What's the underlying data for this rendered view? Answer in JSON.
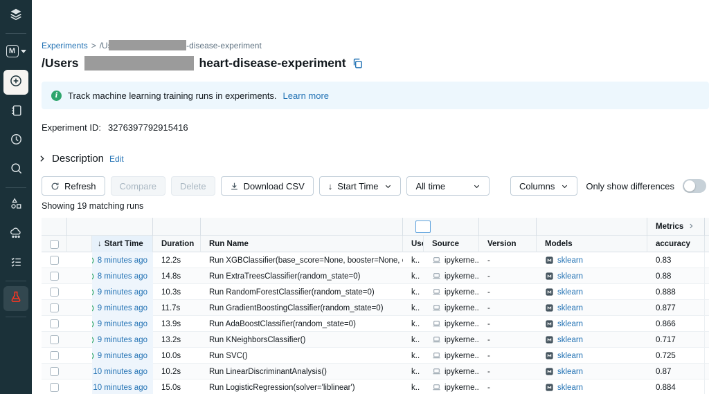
{
  "colors": {
    "sidebar_bg": "#1B3139",
    "accent_red": "#FF3621",
    "link_blue": "#2272B4",
    "banner_bg": "#EDF7FD",
    "info_green": "#2EA56C",
    "sorted_column_tint": "#EEF5FC",
    "redaction_gray": "#9B9B9B"
  },
  "sidebar": {
    "items": [
      {
        "icon": "layers-icon"
      },
      {
        "icon": "workspace-m-icon",
        "label": "M"
      },
      {
        "icon": "plus-circle-icon"
      },
      {
        "icon": "notebook-icon"
      },
      {
        "icon": "clock-icon"
      },
      {
        "icon": "search-icon"
      },
      {
        "icon": "shapes-icon"
      },
      {
        "icon": "cloud-compute-icon"
      },
      {
        "icon": "checklist-icon"
      },
      {
        "icon": "flask-icon",
        "selected": true
      }
    ]
  },
  "breadcrumb": {
    "root": "Experiments",
    "separator": ">",
    "crumb_prefix": "/User",
    "crumb_suffix": "eart-disease-experiment"
  },
  "header": {
    "title_prefix": "/Users",
    "title_name": "heart-disease-experiment"
  },
  "banner": {
    "text": "Track machine learning training runs in experiments.",
    "link": "Learn more"
  },
  "experiment": {
    "id_label": "Experiment ID:",
    "id_value": "3276397792915416"
  },
  "description": {
    "label": "Description",
    "edit": "Edit"
  },
  "toolbar": {
    "refresh": "Refresh",
    "compare": "Compare",
    "delete": "Delete",
    "download_csv": "Download CSV",
    "sort_arrow": "↓",
    "sort_label": "Start Time",
    "time_filter": "All time",
    "columns": "Columns",
    "only_show_differences": "Only show differences",
    "differences_toggle_state": "off"
  },
  "status_text": "Showing 19 matching runs",
  "table": {
    "metrics_group": "Metrics",
    "headers": {
      "start_time": "Start Time",
      "sort_arrow": "↓",
      "duration": "Duration",
      "run_name": "Run Name",
      "user": "User",
      "source": "Source",
      "version": "Version",
      "models": "Models",
      "accuracy": "accuracy"
    },
    "rows": [
      {
        "start_time": "8 minutes ago",
        "duration": "12.2s",
        "run_name": "Run XGBClassifier(base_score=None, booster=None, call...",
        "user": "k..",
        "source": "ipykerne...",
        "version": "-",
        "model": "sklearn",
        "accuracy": "0.83"
      },
      {
        "start_time": "8 minutes ago",
        "duration": "14.8s",
        "run_name": "Run ExtraTreesClassifier(random_state=0)",
        "user": "k..",
        "source": "ipykerne...",
        "version": "-",
        "model": "sklearn",
        "accuracy": "0.88"
      },
      {
        "start_time": "9 minutes ago",
        "duration": "10.3s",
        "run_name": "Run RandomForestClassifier(random_state=0)",
        "user": "k..",
        "source": "ipykerne...",
        "version": "-",
        "model": "sklearn",
        "accuracy": "0.888"
      },
      {
        "start_time": "9 minutes ago",
        "duration": "11.7s",
        "run_name": "Run GradientBoostingClassifier(random_state=0)",
        "user": "k..",
        "source": "ipykerne...",
        "version": "-",
        "model": "sklearn",
        "accuracy": "0.877"
      },
      {
        "start_time": "9 minutes ago",
        "duration": "13.9s",
        "run_name": "Run AdaBoostClassifier(random_state=0)",
        "user": "k..",
        "source": "ipykerne...",
        "version": "-",
        "model": "sklearn",
        "accuracy": "0.866"
      },
      {
        "start_time": "9 minutes ago",
        "duration": "13.2s",
        "run_name": "Run KNeighborsClassifier()",
        "user": "k..",
        "source": "ipykerne...",
        "version": "-",
        "model": "sklearn",
        "accuracy": "0.717"
      },
      {
        "start_time": "9 minutes ago",
        "duration": "10.0s",
        "run_name": "Run SVC()",
        "user": "k..",
        "source": "ipykerne...",
        "version": "-",
        "model": "sklearn",
        "accuracy": "0.725"
      },
      {
        "start_time": "10 minutes ago",
        "duration": "10.2s",
        "run_name": "Run LinearDiscriminantAnalysis()",
        "user": "k..",
        "source": "ipykerne...",
        "version": "-",
        "model": "sklearn",
        "accuracy": "0.87"
      },
      {
        "start_time": "10 minutes ago",
        "duration": "15.0s",
        "run_name": "Run LogisticRegression(solver='liblinear')",
        "user": "k..",
        "source": "ipykerne...",
        "version": "-",
        "model": "sklearn",
        "accuracy": "0.884"
      }
    ]
  }
}
